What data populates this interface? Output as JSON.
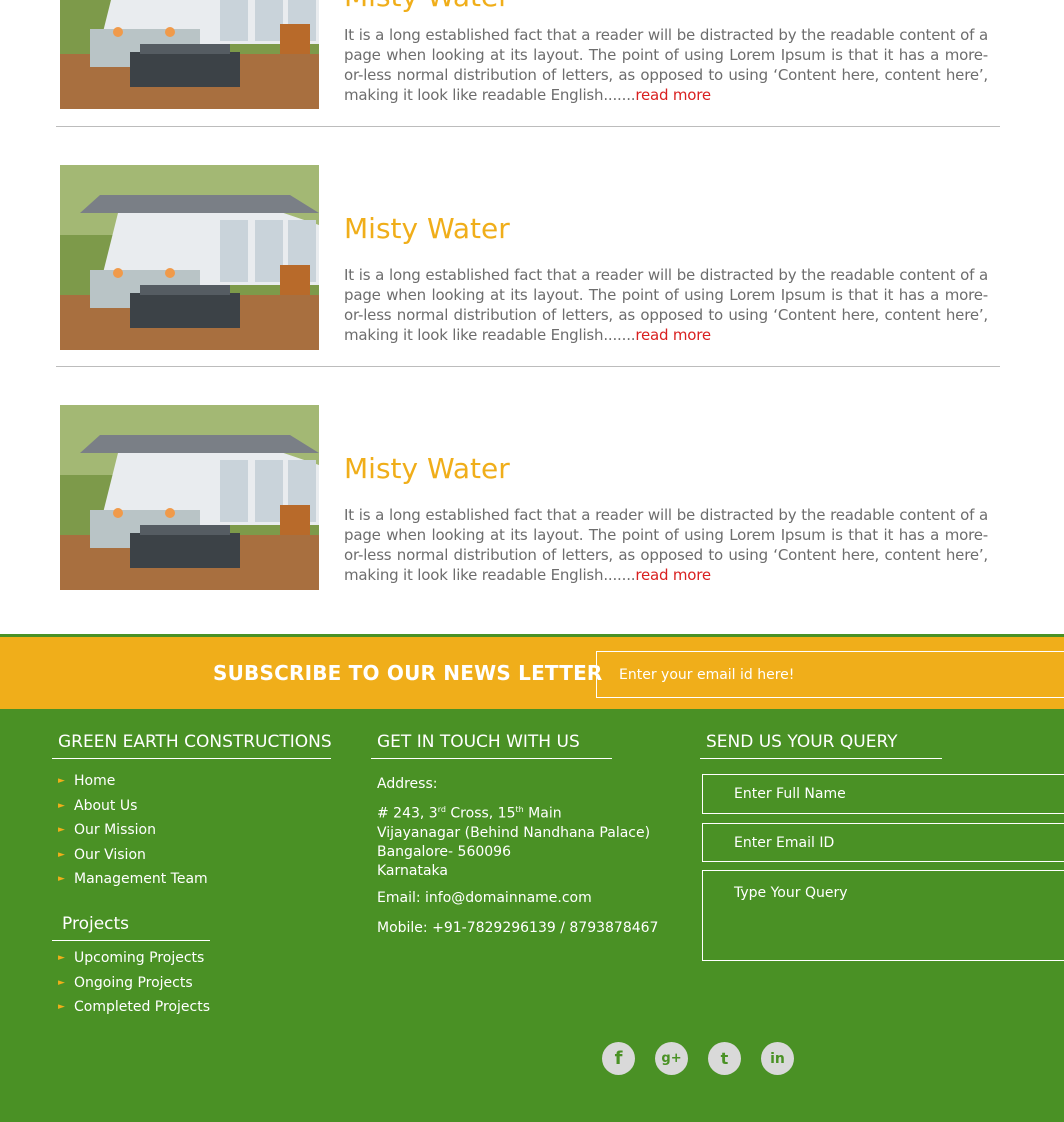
{
  "articles": [
    {
      "title": "Misty Water",
      "text": "It is a long established fact that a reader will be distracted by the readable content of a page when looking at its layout. The point of using Lorem Ipsum is that it has a more-or-less normal distribution of letters, as opposed to using ‘Content here, content here’, making it look like readable English.......",
      "read_more": "read more"
    },
    {
      "title": "Misty Water",
      "text": "It is a long established fact that a reader will be distracted by the readable content of a page when looking at its layout. The point of using Lorem Ipsum is that it has a more-or-less normal distribution of letters, as opposed to using ‘Content here, content here’, making it look like readable English.......",
      "read_more": "read more"
    },
    {
      "title": "Misty Water",
      "text": "It is a long established fact that a reader will be distracted by the readable content of a page when looking at its layout. The point of using Lorem Ipsum is that it has a more-or-less normal distribution of letters, as opposed to using ‘Content here, content here’, making it look like readable English.......",
      "read_more": "read more"
    }
  ],
  "subscribe": {
    "title": "SUBSCRIBE TO OUR NEWS LETTER",
    "placeholder": "Enter your email id here!"
  },
  "footer": {
    "company_heading": "GREEN EARTH CONSTRUCTIONS",
    "links": [
      "Home",
      "About Us",
      "Our Mission",
      "Our Vision",
      "Management Team"
    ],
    "projects_heading": "Projects",
    "projects": [
      "Upcoming Projects",
      "Ongoing Projects",
      "Completed Projects"
    ],
    "contact_heading": "GET IN TOUCH WITH US",
    "address_label": "Address:",
    "address_line1_a": "# 243, 3",
    "address_line1_sup1": "rd",
    "address_line1_b": " Cross, 15",
    "address_line1_sup2": "th",
    "address_line1_c": " Main",
    "address_line2": "Vijayanagar (Behind Nandhana Palace)",
    "address_line3": "Bangalore- 560096",
    "address_line4": "Karnataka",
    "email": "Email: info@domainname.com",
    "mobile": "Mobile: +91-7829296139 / 8793878467",
    "query_heading": "SEND US YOUR QUERY",
    "name_placeholder": "Enter Full Name",
    "email_placeholder": "Enter Email ID",
    "query_placeholder": "Type Your Query",
    "social": [
      {
        "icon": "facebook-icon",
        "glyph": "f"
      },
      {
        "icon": "google-plus-icon",
        "glyph": "g+"
      },
      {
        "icon": "twitter-icon",
        "glyph": "t"
      },
      {
        "icon": "linkedin-icon",
        "glyph": "in"
      }
    ]
  },
  "colors": {
    "accent_orange": "#f0ae1a",
    "footer_green": "#4a9125",
    "read_more_red": "#d92020",
    "body_text_gray": "#6d6d6d"
  }
}
